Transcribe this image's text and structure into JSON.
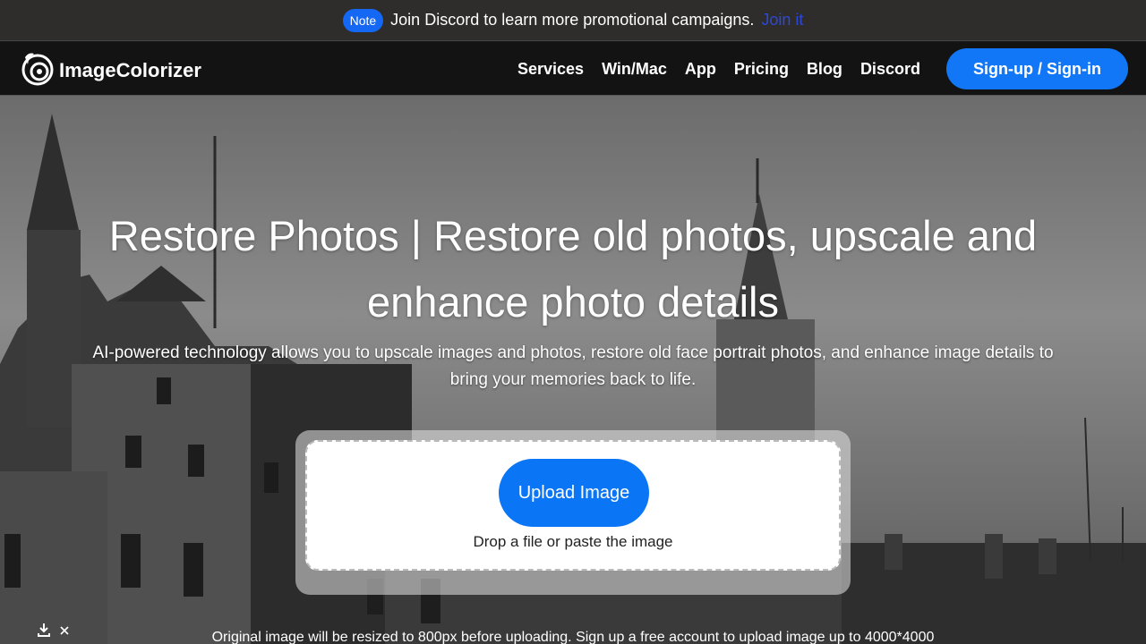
{
  "promo": {
    "badge": "Note",
    "text": "Join Discord to learn more promotional campaigns.",
    "link": "Join it"
  },
  "header": {
    "brand": "ImageColorizer",
    "nav": [
      "Services",
      "Win/Mac",
      "App",
      "Pricing",
      "Blog",
      "Discord"
    ],
    "signin": "Sign-up / Sign-in"
  },
  "hero": {
    "title": "Restore Photos | Restore old photos, upscale and enhance photo details",
    "subtitle": "AI-powered technology allows you to upscale images and photos, restore old face portrait photos, and enhance image details to bring your memories back to life.",
    "upload_label": "Upload Image",
    "upload_hint": "Drop a file or paste the image",
    "resize_note": "Original image will be resized to 800px before uploading. Sign up a free account to upload image up to 4000*4000"
  },
  "colors": {
    "accent": "#1277f6",
    "promo_bg": "#2f2d2c",
    "header_bg": "#131313"
  },
  "icons": {
    "logo": "swirl-logo-icon",
    "download": "download-icon",
    "close": "close-icon"
  }
}
